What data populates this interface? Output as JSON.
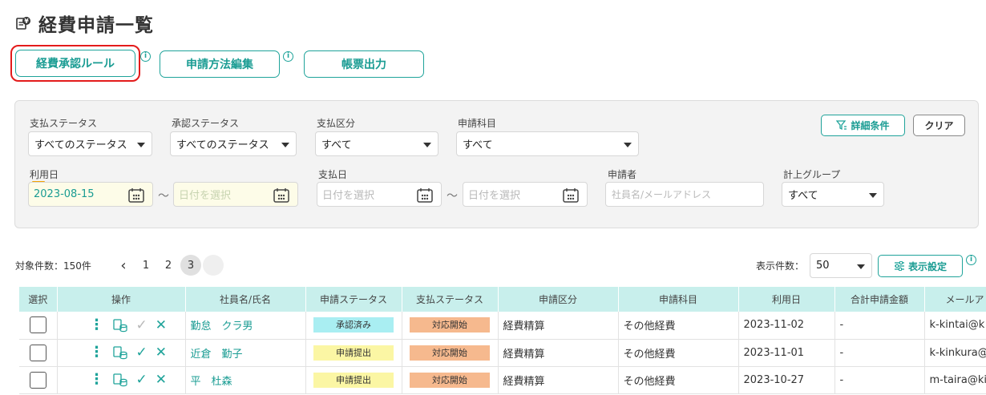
{
  "header": {
    "title": "経費申請一覧",
    "icon": "receipt-yen-icon"
  },
  "actions": {
    "approval_rules": "経費承認ルール",
    "method_edit": "申請方法編集",
    "report_output": "帳票出力",
    "info": "i"
  },
  "filters": {
    "payment_status": {
      "label": "支払ステータス",
      "value": "すべてのステータス"
    },
    "approval_status": {
      "label": "承認ステータス",
      "value": "すべてのステータス"
    },
    "payment_type": {
      "label": "支払区分",
      "value": "すべて"
    },
    "subject": {
      "label": "申請科目",
      "value": "すべて"
    },
    "use_date": {
      "label": "利用日",
      "from": "2023-08-15",
      "to_placeholder": "日付を選択"
    },
    "pay_date": {
      "label": "支払日",
      "from_placeholder": "日付を選択",
      "to_placeholder": "日付を選択"
    },
    "applicant": {
      "label": "申請者",
      "placeholder": "社員名/メールアドレス"
    },
    "group": {
      "label": "計上グループ",
      "value": "すべて"
    },
    "tilde": "〜",
    "detail_button": "詳細条件",
    "clear_button": "クリア"
  },
  "listing": {
    "count_text": "対象件数：150件",
    "pages": [
      "1",
      "2",
      "3"
    ],
    "prev": "‹",
    "active_page": "3",
    "per_page_label": "表示件数：",
    "per_page_value": "50",
    "display_settings": "表示設定"
  },
  "table": {
    "headers": [
      "選択",
      "操作",
      "社員名/氏名",
      "申請ステータス",
      "支払ステータス",
      "申請区分",
      "申請科目",
      "利用日",
      "合計申請金額",
      "メールア"
    ],
    "rows": [
      {
        "name": "勤怠　クラ男",
        "status": "承認済み",
        "status_color": "#a9eef2",
        "pay": "対応開始",
        "type": "経費精算",
        "subject": "その他経費",
        "date": "2023-11-02",
        "amount": "-",
        "email": "k-kintai@k"
      },
      {
        "name": "近倉　勤子",
        "status": "申請提出",
        "status_color": "#fbf6a4",
        "pay": "対応開始",
        "type": "経費精算",
        "subject": "その他経費",
        "date": "2023-11-01",
        "amount": "-",
        "email": "k-kinkura@"
      },
      {
        "name": "平　杜森",
        "status": "申請提出",
        "status_color": "#fbf6a4",
        "pay": "対応開始",
        "type": "経費精算",
        "subject": "その他経費",
        "date": "2023-10-27",
        "amount": "-",
        "email": "m-taira@ki"
      }
    ]
  },
  "colors": {
    "accent": "#1fa39a",
    "highlight": "#e31b1b",
    "header_bg": "#c8efec"
  }
}
